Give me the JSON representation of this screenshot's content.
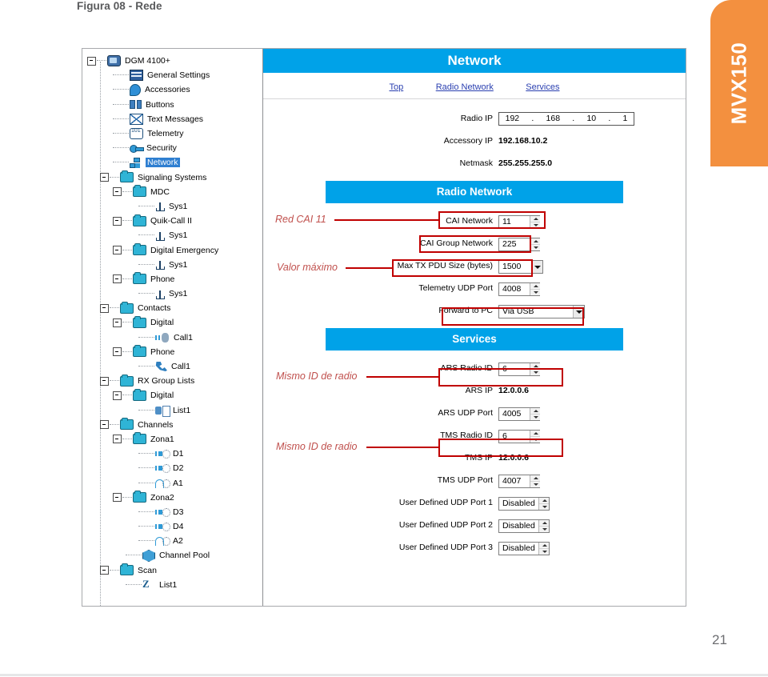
{
  "figure": {
    "caption": "Figura 08 - Rede"
  },
  "side_tab": {
    "label": "MVX150",
    "color": "#f3903f"
  },
  "footer": {
    "page_number": "21"
  },
  "theme": {
    "band_blue": "#00a2e8",
    "annotation_red": "#c00000",
    "annotation_text": "#c0504d",
    "selection_blue": "#2f7fd1"
  },
  "tree": {
    "items": [
      {
        "label": "DGM 4100+",
        "level": 0,
        "icon": "radio-icon",
        "expander": true,
        "selected": false
      },
      {
        "label": "General Settings",
        "level": 2,
        "icon": "general-settings-icon",
        "expander": false,
        "selected": false
      },
      {
        "label": "Accessories",
        "level": 2,
        "icon": "accessories-icon",
        "expander": false,
        "selected": false
      },
      {
        "label": "Buttons",
        "level": 2,
        "icon": "buttons-icon",
        "expander": false,
        "selected": false
      },
      {
        "label": "Text Messages",
        "level": 2,
        "icon": "mail-icon",
        "expander": false,
        "selected": false
      },
      {
        "label": "Telemetry",
        "level": 2,
        "icon": "telemetry-icon",
        "expander": false,
        "selected": false
      },
      {
        "label": "Security",
        "level": 2,
        "icon": "key-icon",
        "expander": false,
        "selected": false
      },
      {
        "label": "Network",
        "level": 2,
        "icon": "network-icon",
        "expander": false,
        "selected": true
      },
      {
        "label": "Signaling Systems",
        "level": 1,
        "icon": "folder-icon",
        "expander": true,
        "selected": false
      },
      {
        "label": "MDC",
        "level": 2,
        "icon": "folder-icon",
        "expander": true,
        "selected": false
      },
      {
        "label": "Sys1",
        "level": 4,
        "icon": "antenna-icon",
        "expander": false,
        "selected": false
      },
      {
        "label": "Quik-Call II",
        "level": 2,
        "icon": "folder-icon",
        "expander": true,
        "selected": false
      },
      {
        "label": "Sys1",
        "level": 4,
        "icon": "antenna-icon",
        "expander": false,
        "selected": false
      },
      {
        "label": "Digital Emergency",
        "level": 2,
        "icon": "folder-icon",
        "expander": true,
        "selected": false
      },
      {
        "label": "Sys1",
        "level": 4,
        "icon": "antenna-icon",
        "expander": false,
        "selected": false
      },
      {
        "label": "Phone",
        "level": 2,
        "icon": "folder-icon",
        "expander": true,
        "selected": false
      },
      {
        "label": "Sys1",
        "level": 4,
        "icon": "antenna-icon",
        "expander": false,
        "selected": false
      },
      {
        "label": "Contacts",
        "level": 1,
        "icon": "folder-icon",
        "expander": true,
        "selected": false
      },
      {
        "label": "Digital",
        "level": 2,
        "icon": "folder-icon",
        "expander": true,
        "selected": false
      },
      {
        "label": "Call1",
        "level": 4,
        "icon": "digital-call-icon",
        "expander": false,
        "selected": false
      },
      {
        "label": "Phone",
        "level": 2,
        "icon": "folder-icon",
        "expander": true,
        "selected": false
      },
      {
        "label": "Call1",
        "level": 4,
        "icon": "phone-icon",
        "expander": false,
        "selected": false
      },
      {
        "label": "RX Group Lists",
        "level": 1,
        "icon": "folder-icon",
        "expander": true,
        "selected": false
      },
      {
        "label": "Digital",
        "level": 2,
        "icon": "folder-icon",
        "expander": true,
        "selected": false
      },
      {
        "label": "List1",
        "level": 4,
        "icon": "group-list-icon",
        "expander": false,
        "selected": false
      },
      {
        "label": "Channels",
        "level": 1,
        "icon": "folder-icon",
        "expander": true,
        "selected": false
      },
      {
        "label": "Zona1",
        "level": 2,
        "icon": "folder-icon",
        "expander": true,
        "selected": false
      },
      {
        "label": "D1",
        "level": 4,
        "icon": "digital-channel-icon",
        "expander": false,
        "selected": false
      },
      {
        "label": "D2",
        "level": 4,
        "icon": "digital-channel-icon",
        "expander": false,
        "selected": false
      },
      {
        "label": "A1",
        "level": 4,
        "icon": "analog-channel-icon",
        "expander": false,
        "selected": false
      },
      {
        "label": "Zona2",
        "level": 2,
        "icon": "folder-icon",
        "expander": true,
        "selected": false
      },
      {
        "label": "D3",
        "level": 4,
        "icon": "digital-channel-icon",
        "expander": false,
        "selected": false
      },
      {
        "label": "D4",
        "level": 4,
        "icon": "digital-channel-icon",
        "expander": false,
        "selected": false
      },
      {
        "label": "A2",
        "level": 4,
        "icon": "analog-channel-icon",
        "expander": false,
        "selected": false
      },
      {
        "label": "Channel Pool",
        "level": 3,
        "icon": "channel-pool-icon",
        "expander": false,
        "selected": false
      },
      {
        "label": "Scan",
        "level": 1,
        "icon": "folder-icon",
        "expander": true,
        "selected": false
      },
      {
        "label": "List1",
        "level": 3,
        "icon": "scan-icon",
        "expander": false,
        "selected": false
      }
    ]
  },
  "config": {
    "title": "Network",
    "nav": [
      {
        "label": "Top"
      },
      {
        "label": "Radio Network"
      },
      {
        "label": "Services"
      }
    ],
    "top_section": {
      "radio_ip": {
        "label": "Radio IP",
        "octets": [
          "192",
          "168",
          "10",
          "1"
        ],
        "separator": "."
      },
      "accessory_ip": {
        "label": "Accessory IP",
        "value": "192.168.10.2"
      },
      "netmask": {
        "label": "Netmask",
        "value": "255.255.255.0"
      }
    },
    "radio_network": {
      "heading": "Radio Network",
      "fields": [
        {
          "label": "CAI Network",
          "value": "11",
          "control": "spinner"
        },
        {
          "label": "CAI Group Network",
          "value": "225",
          "control": "spinner"
        },
        {
          "label": "Max TX PDU Size (bytes)",
          "value": "1500",
          "control": "combo"
        },
        {
          "label": "Telemetry UDP Port",
          "value": "4008",
          "control": "spinner"
        },
        {
          "label": "Forward to PC",
          "value": "Via USB",
          "control": "combo"
        }
      ]
    },
    "services": {
      "heading": "Services",
      "fields": [
        {
          "label": "ARS Radio ID",
          "value": "6",
          "control": "spinner"
        },
        {
          "label": "ARS IP",
          "value": "12.0.0.6",
          "control": "static"
        },
        {
          "label": "ARS UDP Port",
          "value": "4005",
          "control": "spinner"
        },
        {
          "label": "TMS Radio ID",
          "value": "6",
          "control": "spinner"
        },
        {
          "label": "TMS IP",
          "value": "12.0.0.6",
          "control": "static"
        },
        {
          "label": "TMS UDP Port",
          "value": "4007",
          "control": "spinner"
        },
        {
          "label": "User Defined UDP Port 1",
          "value": "Disabled",
          "control": "spinner"
        },
        {
          "label": "User Defined UDP Port 2",
          "value": "Disabled",
          "control": "spinner"
        },
        {
          "label": "User Defined UDP Port 3",
          "value": "Disabled",
          "control": "spinner"
        }
      ]
    }
  },
  "annotations": [
    {
      "text": "Red CAI 11",
      "target": "CAI Network"
    },
    {
      "text": "Valor máximo",
      "target": "Max TX PDU Size (bytes)"
    },
    {
      "text": "Mismo ID de radio",
      "target": "ARS Radio ID"
    },
    {
      "text": "Mismo ID de radio",
      "target": "TMS Radio ID"
    }
  ]
}
